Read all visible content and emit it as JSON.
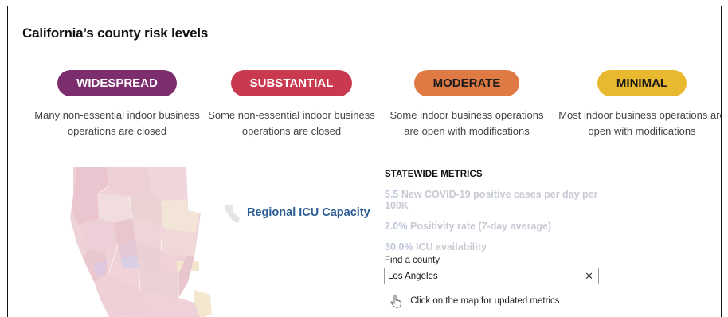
{
  "title": "California’s county risk levels",
  "tiers": [
    {
      "label": "WIDESPREAD",
      "color": "#7b2d6e",
      "text_color": "#ffffff",
      "description": "Many non-essential indoor business operations are closed"
    },
    {
      "label": "SUBSTANTIAL",
      "color": "#c93a50",
      "text_color": "#ffffff",
      "description": "Some non-essential indoor business operations are closed"
    },
    {
      "label": "MODERATE",
      "color": "#e07a44",
      "text_color": "#1a1a1a",
      "description": "Some indoor business operations are open with modifications"
    },
    {
      "label": "MINIMAL",
      "color": "#e8b92e",
      "text_color": "#1a1a1a",
      "description": "Most indoor business operations are open with modifications"
    }
  ],
  "regional_icu_link": "Regional ICU Capacity",
  "metrics": {
    "title": "STATEWIDE METRICS",
    "items": [
      {
        "value": "5.5",
        "label": "New COVID-19 positive cases per day per 100K"
      },
      {
        "value": "2.0%",
        "label": "Positivity rate (7-day average)"
      },
      {
        "value": "30.0%",
        "label": "ICU availability"
      }
    ]
  },
  "find_county": {
    "label": "Find a county",
    "value": "Los Angeles"
  },
  "map_hint": "Click on the map for updated metrics"
}
